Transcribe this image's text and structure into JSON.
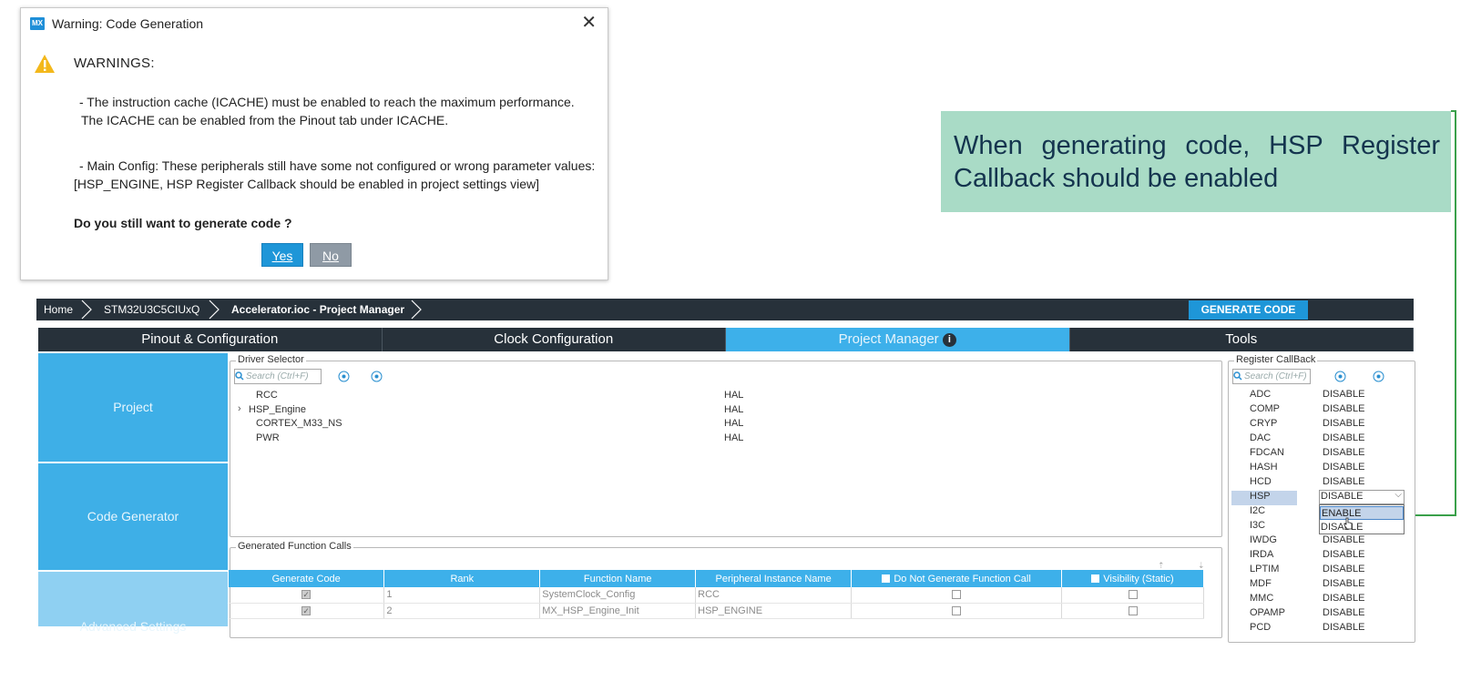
{
  "dialog": {
    "logo": "MX",
    "title": "Warning: Code Generation",
    "close": "✕",
    "heading": "WARNINGS:",
    "lines": [
      "- The instruction cache (ICACHE) must be enabled to reach the maximum performance.",
      "The ICACHE can be enabled from the Pinout tab under ICACHE.",
      "- Main Config: These peripherals still have some not configured or wrong parameter values:",
      "[HSP_ENGINE, HSP Register Callback should be enabled in project settings view]"
    ],
    "question": "Do you still want to generate code ?",
    "yes": "Yes",
    "no": "No"
  },
  "callout": {
    "text": "When generating code, HSP Register Callback should be enabled",
    "color": "#a9dbc6",
    "arrow_color": "#3aa04a"
  },
  "breadcrumb": {
    "items": [
      "Home",
      "STM32U3C5CIUxQ",
      "Accelerator.ioc - Project Manager"
    ],
    "generate_code": "GENERATE CODE"
  },
  "tabs": [
    {
      "label": "Pinout & Configuration",
      "active": false
    },
    {
      "label": "Clock Configuration",
      "active": false
    },
    {
      "label": "Project Manager",
      "active": true
    },
    {
      "label": "Tools",
      "active": false
    }
  ],
  "leftnav": [
    "Project",
    "Code Generator",
    "Advanced Settings"
  ],
  "driver_selector": {
    "label": "Driver Selector",
    "search_placeholder": "Search (Ctrl+F)",
    "rows": [
      {
        "name": "RCC",
        "driver": "HAL",
        "expandable": false
      },
      {
        "name": "HSP_Engine",
        "driver": "HAL",
        "expandable": true
      },
      {
        "name": "CORTEX_M33_NS",
        "driver": "HAL",
        "expandable": false
      },
      {
        "name": "PWR",
        "driver": "HAL",
        "expandable": false
      }
    ]
  },
  "generated_calls": {
    "label": "Generated Function Calls",
    "headers": [
      "Generate Code",
      "Rank",
      "Function Name",
      "Peripheral Instance Name",
      "Do Not Generate Function Call",
      "Visibility (Static)"
    ],
    "rows": [
      {
        "generate": true,
        "rank": "1",
        "function": "SystemClock_Config",
        "instance": "RCC"
      },
      {
        "generate": true,
        "rank": "2",
        "function": "MX_HSP_Engine_Init",
        "instance": "HSP_ENGINE"
      }
    ]
  },
  "register_callback": {
    "label": "Register CallBack",
    "search_placeholder": "Search (Ctrl+F)",
    "rows": [
      {
        "name": "ADC",
        "value": "DISABLE"
      },
      {
        "name": "COMP",
        "value": "DISABLE"
      },
      {
        "name": "CRYP",
        "value": "DISABLE"
      },
      {
        "name": "DAC",
        "value": "DISABLE"
      },
      {
        "name": "FDCAN",
        "value": "DISABLE"
      },
      {
        "name": "HASH",
        "value": "DISABLE"
      },
      {
        "name": "HCD",
        "value": "DISABLE"
      },
      {
        "name": "HSP",
        "value": "DISABLE"
      },
      {
        "name": "I2C",
        "value": ""
      },
      {
        "name": "I3C",
        "value": ""
      },
      {
        "name": "IWDG",
        "value": "DISABLE"
      },
      {
        "name": "IRDA",
        "value": "DISABLE"
      },
      {
        "name": "LPTIM",
        "value": "DISABLE"
      },
      {
        "name": "MDF",
        "value": "DISABLE"
      },
      {
        "name": "MMC",
        "value": "DISABLE"
      },
      {
        "name": "OPAMP",
        "value": "DISABLE"
      },
      {
        "name": "PCD",
        "value": "DISABLE"
      }
    ],
    "dropdown_value": "DISABLE",
    "dropdown_options": [
      "ENABLE",
      "DISABLE"
    ]
  },
  "colors": {
    "accent": "#3db0ea",
    "dark_bar": "#27313a",
    "button_blue": "#1e96d8"
  }
}
